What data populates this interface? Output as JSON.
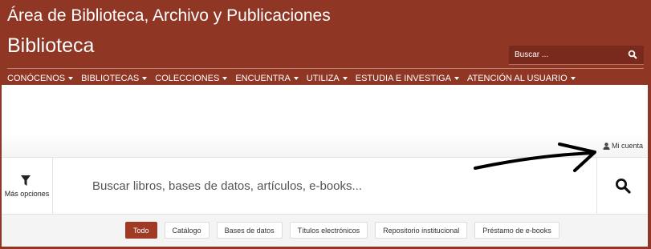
{
  "header": {
    "site_title": "Área de Biblioteca, Archivo y Publicaciones",
    "subtitle": "Biblioteca",
    "search": {
      "placeholder": "Buscar ..."
    }
  },
  "nav": {
    "items": [
      {
        "label": "CONÓCENOS"
      },
      {
        "label": "BIBLIOTECAS"
      },
      {
        "label": "COLECCIONES"
      },
      {
        "label": "ENCUENTRA"
      },
      {
        "label": "UTILIZA"
      },
      {
        "label": "ESTUDIA E INVESTIGA"
      },
      {
        "label": "ATENCIÓN AL USUARIO"
      }
    ]
  },
  "account": {
    "label": "Mi cuenta"
  },
  "search_panel": {
    "more_options_label": "Más opciones",
    "placeholder": "Buscar libros, bases de datos, artículos, e-books..."
  },
  "filters": [
    {
      "label": "Todo",
      "active": true
    },
    {
      "label": "Catálogo",
      "active": false
    },
    {
      "label": "Bases de datos",
      "active": false
    },
    {
      "label": "Títulos electrónicos",
      "active": false
    },
    {
      "label": "Repositorio institucional",
      "active": false
    },
    {
      "label": "Préstamo de e-books",
      "active": false
    }
  ],
  "colors": {
    "brand": "#8f3625",
    "active_filter": "#a13a25"
  },
  "icons": [
    "search-icon",
    "caret-down-icon",
    "user-icon",
    "filter-funnel-icon",
    "magnifier-icon",
    "annotation-arrow"
  ]
}
